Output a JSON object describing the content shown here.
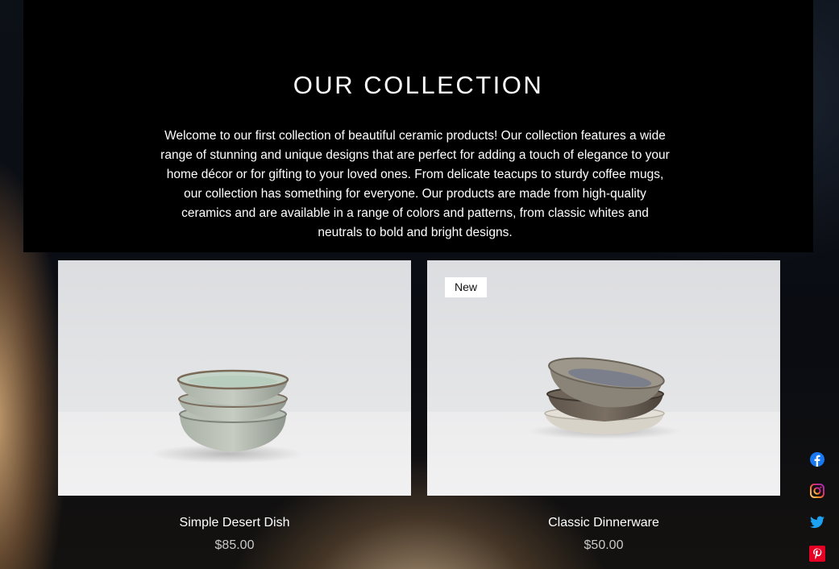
{
  "hero": {
    "title": "OUR COLLECTION",
    "description": "Welcome to our first collection of beautiful ceramic products! Our collection features a wide range of stunning and unique designs that are perfect for adding a touch of elegance to your home décor or for gifting to your loved ones. From delicate teacups to sturdy coffee mugs, our collection has something for everyone. Our products are made from high-quality ceramics and are available in a range of colors and patterns, from classic whites and neutrals to bold and bright designs."
  },
  "products": [
    {
      "name": "Simple Desert Dish",
      "price": "$85.00",
      "badge": ""
    },
    {
      "name": "Classic Dinnerware",
      "price": "$50.00",
      "badge": "New"
    }
  ],
  "social": [
    {
      "icon": "facebook-icon",
      "color": "#1877f2"
    },
    {
      "icon": "instagram-icon",
      "color": "#e1306c"
    },
    {
      "icon": "twitter-icon",
      "color": "#1da1f2"
    },
    {
      "icon": "pinterest-icon",
      "color": "#e60023"
    }
  ]
}
